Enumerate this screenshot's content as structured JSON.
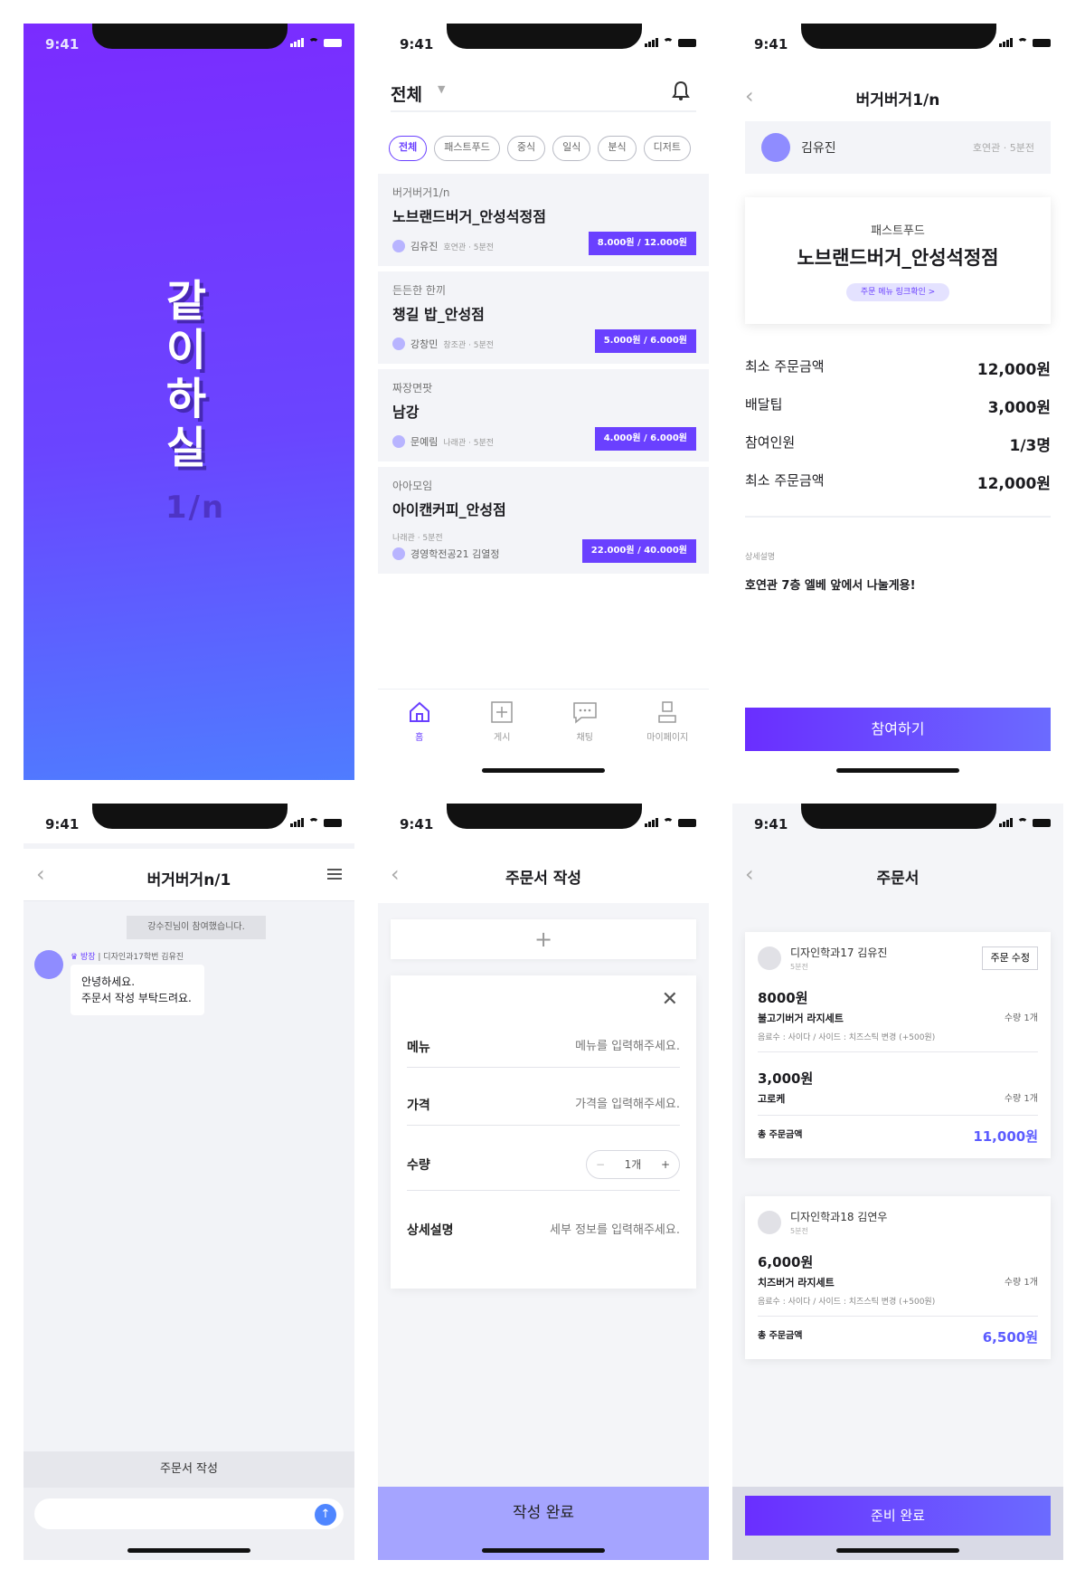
{
  "status_time": "9:41",
  "splash": {
    "title": "같이하실",
    "subtitle": "1/n"
  },
  "feed": {
    "filter_label": "전체",
    "chips": [
      "전체",
      "패스트푸드",
      "중식",
      "일식",
      "분식",
      "디저트"
    ],
    "posts": [
      {
        "category": "버거버거1/n",
        "name": "노브랜드버거_안성석정점",
        "author": "김유진",
        "sub": "호연관 · 5분전",
        "price": "8.000원 / 12.000원"
      },
      {
        "category": "든든한 한끼",
        "name": "챙길 밥_안성점",
        "author": "강창민",
        "sub": "창조관 · 5분전",
        "price": "5.000원 / 6.000원"
      },
      {
        "category": "짜장면팟",
        "name": "남강",
        "author": "문예림",
        "sub": "나래관 · 5분전",
        "price": "4.000원 / 6.000원"
      },
      {
        "category": "아아모임",
        "name": "아이캔커피_안성점",
        "author": "경영학전공21 김열정",
        "sub": "나래관 · 5분전",
        "price": "22.000원 / 40.000원"
      }
    ],
    "tabs": [
      {
        "label": "홈",
        "icon": "home-icon"
      },
      {
        "label": "게시",
        "icon": "plus-square-icon"
      },
      {
        "label": "채팅",
        "icon": "chat-icon"
      },
      {
        "label": "마이페이지",
        "icon": "user-icon"
      }
    ]
  },
  "detail": {
    "title": "버거버거1/n",
    "author": "김유진",
    "author_sub": "호연관 · 5분전",
    "store_category": "패스트푸드",
    "store_name": "노브랜드버거_안성석정점",
    "menu_link": "주문 메뉴 링크확인 >",
    "rows": [
      {
        "label": "최소 주문금액",
        "value": "12,000원"
      },
      {
        "label": "배달팁",
        "value": "3,000원"
      },
      {
        "label": "참여인원",
        "value": "1/3명"
      },
      {
        "label": "최소 주문금액",
        "value": "12,000원"
      }
    ],
    "desc_label": "상세설명",
    "desc_text": "호연관 7층 엘베 앞에서 나눌게용!",
    "join_button": "참여하기"
  },
  "chat": {
    "title": "버거버거n/1",
    "system_message": "강수진님이 참여했습니다.",
    "sender_role": "방장",
    "sender_name": "디자인과17학번 김유진",
    "message": "안녕하세요.\n주문서 작성 부탁드려요.",
    "order_button": "주문서 작성",
    "send_icon": "arrow-up-icon"
  },
  "order_form": {
    "title": "주문서 작성",
    "add_label": "+",
    "fields": [
      {
        "label": "메뉴",
        "placeholder": "메뉴를 입력해주세요."
      },
      {
        "label": "가격",
        "placeholder": "가격을 입력해주세요."
      },
      {
        "label": "수량",
        "value": "1개"
      },
      {
        "label": "상세설명",
        "placeholder": "세부 정보를 입력해주세요."
      }
    ],
    "submit": "작성 완료"
  },
  "orders": {
    "title": "주문서",
    "edit_button": "주문 수정",
    "total_label": "총 주문금액",
    "cards": [
      {
        "name": "디자인학과17 김유진",
        "time": "5분전",
        "items": [
          {
            "price": "8000원",
            "menu": "불고기버거 라지세트",
            "qty": "수량 1개",
            "option": "음료수 : 사이다 / 사이드 : 치즈스틱 변경 (+500원)"
          },
          {
            "price": "3,000원",
            "menu": "고로케",
            "qty": "수량 1개",
            "option": ""
          }
        ],
        "total": "11,000원"
      },
      {
        "name": "디자인학과18 김연우",
        "time": "5분전",
        "items": [
          {
            "price": "6,000원",
            "menu": "치즈버거 라지세트",
            "qty": "수량 1개",
            "option": "음료수 : 사이다 / 사이드 : 치즈스틱 변경 (+500원)"
          }
        ],
        "total": "6,500원"
      }
    ],
    "ready_button": "준비 완료"
  },
  "colors": {
    "accent": "#6a40ff",
    "splash_top": "#7a2cff",
    "splash_bottom": "#4f7cff"
  }
}
